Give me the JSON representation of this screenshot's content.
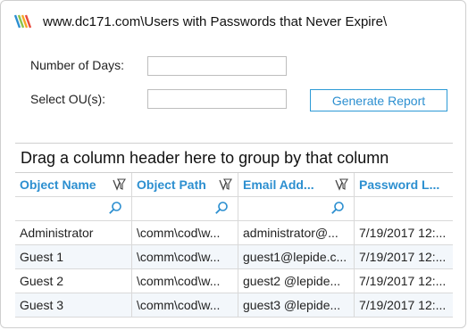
{
  "header": {
    "title": "www.dc171.com\\Users with Passwords that Never Expire\\"
  },
  "form": {
    "days_label": "Number of Days:",
    "days_value": "",
    "ou_label": "Select OU(s):",
    "ou_value": "",
    "generate_label": "Generate Report"
  },
  "grid": {
    "group_panel_text": "Drag a column header here to group by that column",
    "columns": [
      "Object Name",
      "Object Path",
      "Email Add...",
      "Password L..."
    ],
    "rows": [
      [
        "Administrator",
        "\\comm\\cod\\w...",
        "administrator@...",
        "7/19/2017 12:..."
      ],
      [
        "Guest 1",
        "\\comm\\cod\\w...",
        "guest1@lepide.c...",
        "7/19/2017 12:..."
      ],
      [
        "Guest 2",
        "\\comm\\cod\\w...",
        "guest2 @lepide...",
        "7/19/2017 12:..."
      ],
      [
        "Guest 3",
        "\\comm\\cod\\w...",
        "guest3 @lepide...",
        "7/19/2017 12:..."
      ]
    ]
  },
  "colors": {
    "accent": "#2c8fd0",
    "logo": [
      "#e84a3c",
      "#f5a623",
      "#2c8fd0",
      "#8bc34a"
    ]
  }
}
